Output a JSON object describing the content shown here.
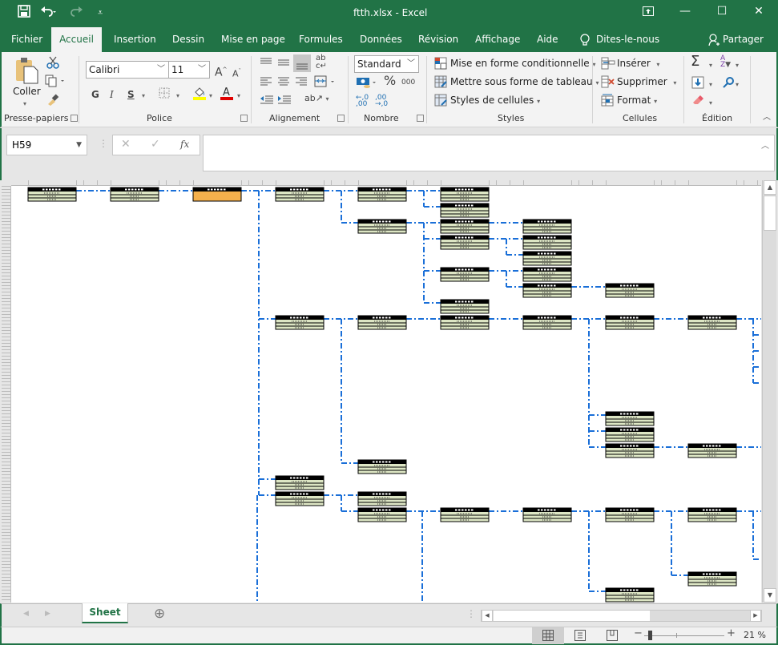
{
  "window": {
    "title": "ftth.xlsx  -  Excel",
    "quick_access": [
      {
        "icon": "save-icon",
        "glyph": "💾"
      },
      {
        "icon": "undo-icon",
        "glyph": "↶"
      },
      {
        "icon": "redo-icon",
        "glyph": "↷"
      },
      {
        "icon": "customize-qat-icon",
        "glyph": "⌄"
      }
    ],
    "controls": {
      "ribbon_display": "⬆",
      "minimize": "—",
      "maximize": "☐",
      "close": "✕"
    }
  },
  "tabs": [
    {
      "label": "Fichier",
      "active": false
    },
    {
      "label": "Accueil",
      "active": true
    },
    {
      "label": "Insertion",
      "active": false
    },
    {
      "label": "Dessin",
      "active": false
    },
    {
      "label": "Mise en page",
      "active": false
    },
    {
      "label": "Formules",
      "active": false
    },
    {
      "label": "Données",
      "active": false
    },
    {
      "label": "Révision",
      "active": false
    },
    {
      "label": "Affichage",
      "active": false
    },
    {
      "label": "Aide",
      "active": false
    }
  ],
  "tell_me": {
    "icon": "lightbulb-icon",
    "label": "Dites-le-nous"
  },
  "share": {
    "icon": "person-add-icon",
    "label": "Partager"
  },
  "ribbon": {
    "clipboard": {
      "label": "Presse-papiers",
      "paste": "Coller"
    },
    "font": {
      "label": "Police",
      "font_name": "Calibri",
      "font_size": "11",
      "bold": "G",
      "italic": "I",
      "underline": "S",
      "highlight_color": "#ffff00",
      "font_color": "#e00000"
    },
    "alignment": {
      "label": "Alignement"
    },
    "number": {
      "label": "Nombre",
      "format": "Standard",
      "percent": "%",
      "thousands": "000"
    },
    "styles": {
      "label": "Styles",
      "conditional": "Mise en forme conditionnelle",
      "as_table": "Mettre sous forme de tableau",
      "cell_styles": "Styles de cellules"
    },
    "cells": {
      "label": "Cellules",
      "insert": "Insérer",
      "delete": "Supprimer",
      "format": "Format"
    },
    "editing": {
      "label": "Édition"
    }
  },
  "formula_bar": {
    "name_box": "H59",
    "cancel": "✕",
    "enter": "✓",
    "fx": "fx",
    "value": ""
  },
  "sheet_tabs": [
    {
      "label": "Sheet",
      "active": true
    }
  ],
  "add_sheet": "⊕",
  "status": {
    "zoom": "21 %"
  },
  "diagram": {
    "columns": 9,
    "selected_node": {
      "col": 2,
      "row": 0
    },
    "nodes": [
      [
        0,
        0
      ],
      [
        1,
        0
      ],
      [
        2,
        0
      ],
      [
        3,
        0
      ],
      [
        4,
        0
      ],
      [
        5,
        0
      ],
      [
        5,
        1
      ],
      [
        4,
        2
      ],
      [
        5,
        2
      ],
      [
        6,
        2
      ],
      [
        5,
        3
      ],
      [
        6,
        3
      ],
      [
        6,
        4
      ],
      [
        5,
        5
      ],
      [
        6,
        5
      ],
      [
        6,
        6
      ],
      [
        7,
        6
      ],
      [
        5,
        7
      ],
      [
        3,
        8
      ],
      [
        4,
        8
      ],
      [
        5,
        8
      ],
      [
        6,
        8
      ],
      [
        7,
        8
      ],
      [
        8,
        8
      ],
      [
        7,
        14
      ],
      [
        7,
        15
      ],
      [
        7,
        16
      ],
      [
        8,
        16
      ],
      [
        4,
        17
      ],
      [
        3,
        18
      ],
      [
        3,
        19
      ],
      [
        4,
        19
      ],
      [
        4,
        20
      ],
      [
        5,
        20
      ],
      [
        6,
        20
      ],
      [
        7,
        20
      ],
      [
        8,
        20
      ],
      [
        8,
        24
      ],
      [
        7,
        25
      ]
    ],
    "accent_line_color": "#1a6fd8"
  }
}
